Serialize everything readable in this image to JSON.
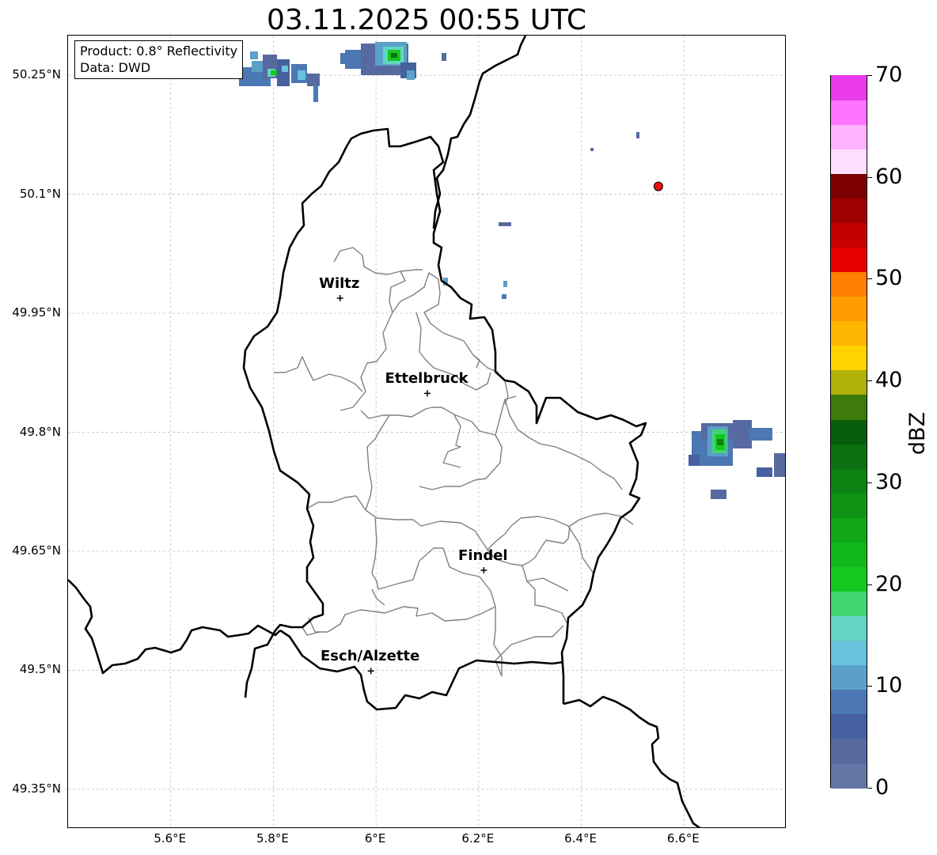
{
  "title": "03.11.2025 00:55 UTC",
  "info": {
    "product": "Product: 0.8° Reflectivity",
    "source": "Data: DWD"
  },
  "axes": {
    "lat_labels": [
      "50.25°N",
      "50.1°N",
      "49.95°N",
      "49.8°N",
      "49.65°N",
      "49.5°N",
      "49.35°N"
    ],
    "lat_values": [
      50.25,
      50.1,
      49.95,
      49.8,
      49.65,
      49.5,
      49.35
    ],
    "lon_labels": [
      "5.6°E",
      "5.8°E",
      "6°E",
      "6.2°E",
      "6.4°E",
      "6.6°E"
    ],
    "lon_values": [
      5.6,
      5.8,
      6.0,
      6.2,
      6.4,
      6.6
    ],
    "lat_range": [
      49.3,
      50.3
    ],
    "lon_range": [
      5.4,
      6.8
    ],
    "grid": true
  },
  "cities": [
    {
      "name": "Wiltz",
      "lon": 5.93,
      "lat": 49.969
    },
    {
      "name": "Ettelbruck",
      "lon": 6.1,
      "lat": 49.849
    },
    {
      "name": "Findel",
      "lon": 6.21,
      "lat": 49.626
    },
    {
      "name": "Esch/Alzette",
      "lon": 5.99,
      "lat": 49.499
    }
  ],
  "marker": {
    "lon": 6.55,
    "lat": 50.11,
    "color": "#ee1111"
  },
  "colorbar": {
    "unit": "dBZ",
    "tick_labels": [
      "0",
      "10",
      "20",
      "30",
      "40",
      "50",
      "60",
      "70"
    ],
    "tick_values": [
      0,
      10,
      20,
      30,
      40,
      50,
      60,
      70
    ],
    "min": 0,
    "max": 70,
    "step": 2.5,
    "colors": [
      "#6475a6",
      "#566a9f",
      "#4660a0",
      "#4b78b2",
      "#5ba0c8",
      "#69c2de",
      "#62d6c2",
      "#41d56f",
      "#14c81e",
      "#12b81b",
      "#10a618",
      "#0f9416",
      "#0d8213",
      "#0b7010",
      "#085d0c",
      "#3e7a0c",
      "#b1b109",
      "#fed300",
      "#feb600",
      "#ff9c00",
      "#ff7f00",
      "#e80000",
      "#c40000",
      "#a10000",
      "#7c0000",
      "#fedffe",
      "#feb3fe",
      "#ff74ff",
      "#e93aeb"
    ]
  },
  "colors": {
    "country_border": "#000000",
    "canton_border": "#808080",
    "grid": "#b8b8b8"
  }
}
